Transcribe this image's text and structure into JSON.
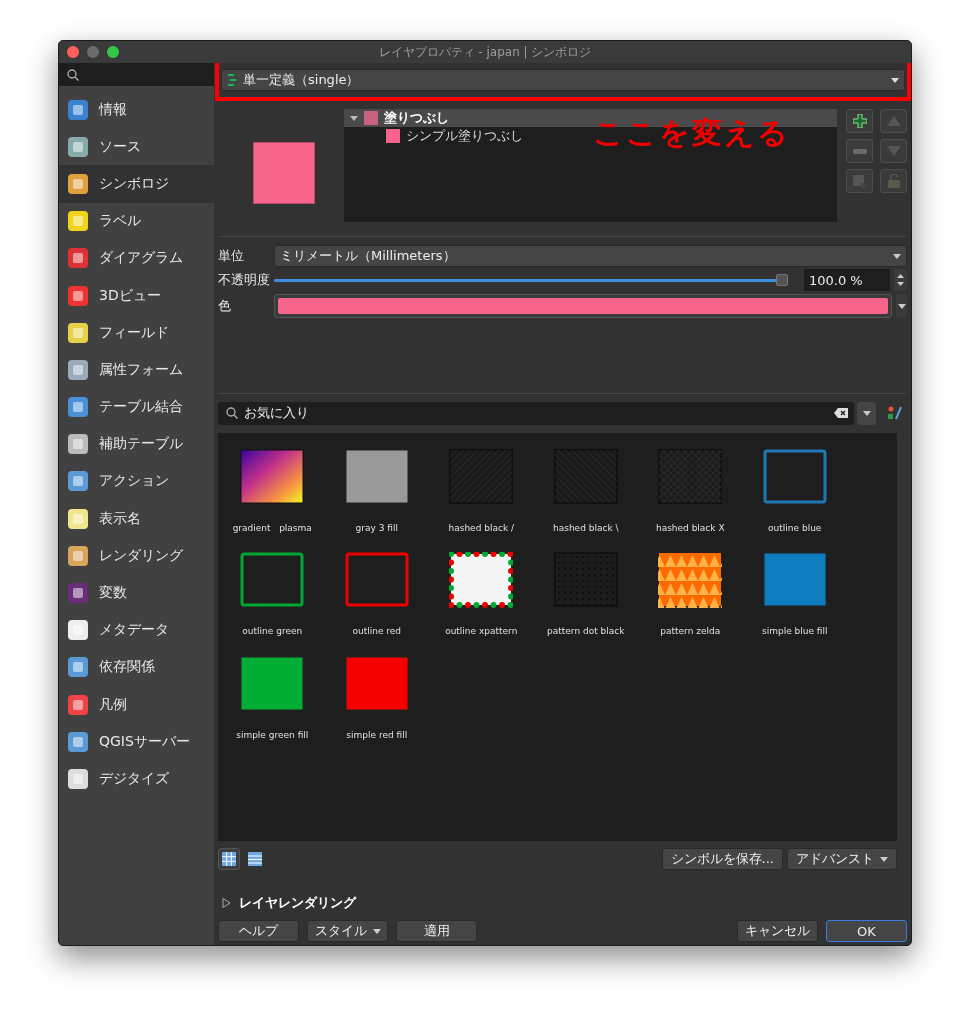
{
  "window": {
    "title": "レイヤプロパティ - japan | シンボロジ"
  },
  "sidebar": {
    "items": [
      {
        "label": "情報",
        "selected": false
      },
      {
        "label": "ソース",
        "selected": false
      },
      {
        "label": "シンボロジ",
        "selected": true
      },
      {
        "label": "ラベル",
        "selected": false
      },
      {
        "label": "ダイアグラム",
        "selected": false
      },
      {
        "label": "3Dビュー",
        "selected": false
      },
      {
        "label": "フィールド",
        "selected": false
      },
      {
        "label": "属性フォーム",
        "selected": false
      },
      {
        "label": "テーブル結合",
        "selected": false
      },
      {
        "label": "補助テーブル",
        "selected": false
      },
      {
        "label": "アクション",
        "selected": false
      },
      {
        "label": "表示名",
        "selected": false
      },
      {
        "label": "レンダリング",
        "selected": false
      },
      {
        "label": "変数",
        "selected": false
      },
      {
        "label": "メタデータ",
        "selected": false
      },
      {
        "label": "依存関係",
        "selected": false
      },
      {
        "label": "凡例",
        "selected": false
      },
      {
        "label": "QGISサーバー",
        "selected": false
      },
      {
        "label": "デジタイズ",
        "selected": false
      }
    ]
  },
  "renderer": {
    "value": "単一定義（single）"
  },
  "annotation": {
    "text": "ここを変える"
  },
  "symbol_tree": [
    {
      "label": "塗りつぶし",
      "expanded": true,
      "selected": true,
      "children": [
        {
          "label": "シンプル塗りつぶし",
          "selected": false
        }
      ]
    }
  ],
  "properties": {
    "unit": {
      "label": "単位",
      "value": "ミリメートル（Millimeters）"
    },
    "opacity": {
      "label": "不透明度",
      "level": 1,
      "value": "100.0 %"
    },
    "color": {
      "label": "色",
      "color": "#f7658b"
    }
  },
  "library": {
    "search": {
      "value": "お気に入り"
    },
    "symbols": [
      {
        "name": "gradient   plasma",
        "kind": "gradient"
      },
      {
        "name": "gray 3 fill",
        "kind": "fill",
        "color": "#9a9a9a"
      },
      {
        "name": "hashed black /",
        "kind": "hatch",
        "color": "#111111"
      },
      {
        "name": "hashed black \\",
        "kind": "backhatch",
        "color": "#111111"
      },
      {
        "name": "hashed black X",
        "kind": "crosshatch",
        "color": "#111111"
      },
      {
        "name": "outline blue",
        "kind": "outline",
        "color": "#1f78b4"
      },
      {
        "name": "outline green",
        "kind": "outline",
        "color": "#00a832"
      },
      {
        "name": "outline red",
        "kind": "outline",
        "color": "#ee0000"
      },
      {
        "name": "outline xpattern",
        "kind": "xpattern",
        "color": "#f5f5f5"
      },
      {
        "name": "pattern dot black",
        "kind": "dotpattern",
        "color": "#111111"
      },
      {
        "name": "pattern zelda",
        "kind": "zelda",
        "color": "#ff6a00"
      },
      {
        "name": "simple blue fill",
        "kind": "fill",
        "color": "#0e7dbf"
      },
      {
        "name": "simple green fill",
        "kind": "fill",
        "color": "#00ad35"
      },
      {
        "name": "simple red fill",
        "kind": "fill",
        "color": "#f50000"
      }
    ]
  },
  "view_modes": [
    {
      "selected": true
    },
    {
      "selected": false
    }
  ],
  "library_buttons": [
    {
      "label": "シンボルを保存...",
      "kind": "plain"
    },
    {
      "label": "アドバンスト",
      "kind": "dropdown"
    }
  ],
  "layer_rendering": {
    "label": "レイヤレンダリング",
    "expanded": false
  },
  "buttons_left": [
    {
      "label": "ヘルプ",
      "kind": "plain"
    },
    {
      "label": "スタイル",
      "kind": "dropdown"
    },
    {
      "label": "適用",
      "kind": "plain"
    }
  ],
  "buttons_right": [
    {
      "label": "キャンセル",
      "default": false
    },
    {
      "label": "OK",
      "default": true
    }
  ]
}
